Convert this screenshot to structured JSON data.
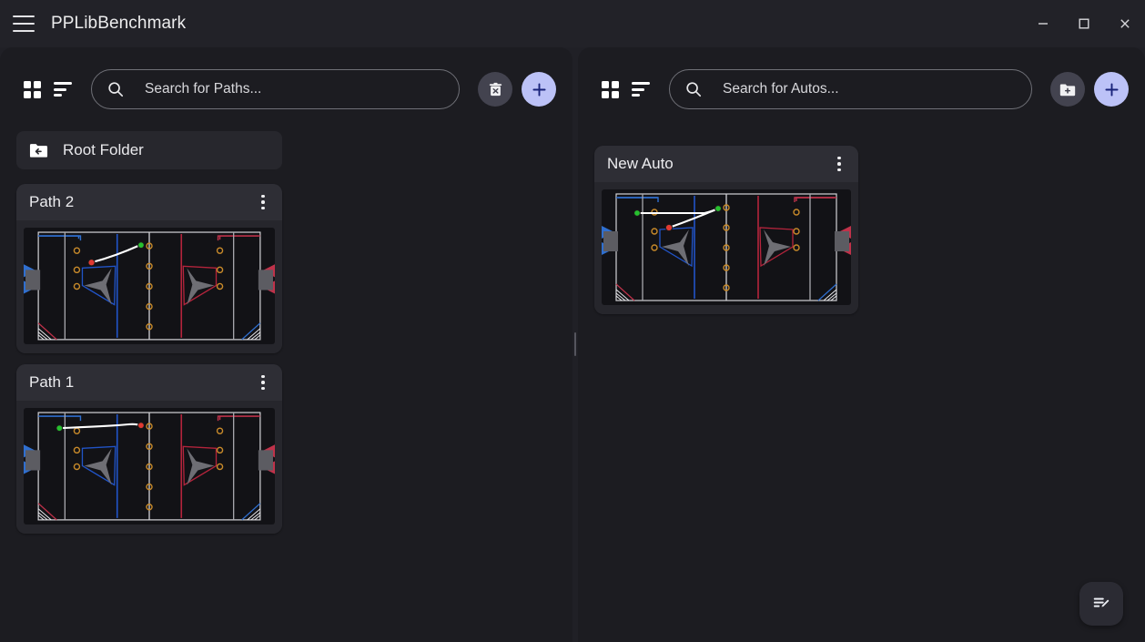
{
  "window": {
    "title": "PPLibBenchmark",
    "menu_icon": "hamburger-menu-icon",
    "controls": {
      "minimize": "minimize-icon",
      "maximize": "maximize-icon",
      "close": "close-icon"
    }
  },
  "paths_panel": {
    "toolbar": {
      "grid_view_icon": "grid-view-icon",
      "sort_icon": "sort-icon",
      "search_icon": "search-icon",
      "search_value": "",
      "search_placeholder": "Search for Paths...",
      "delete_all_icon": "trash-delete-icon",
      "add_icon": "plus-icon"
    },
    "root_folder": {
      "icon": "folder-back-icon",
      "label": "Root Folder"
    },
    "cards": [
      {
        "title": "Path 2",
        "menu_icon": "kebab-menu-icon",
        "preview": "path-preview-field"
      },
      {
        "title": "Path 1",
        "menu_icon": "kebab-menu-icon",
        "preview": "path-preview-field"
      }
    ]
  },
  "autos_panel": {
    "toolbar": {
      "grid_view_icon": "grid-view-icon",
      "sort_icon": "sort-icon",
      "search_icon": "search-icon",
      "search_value": "",
      "search_placeholder": "Search for Autos...",
      "new_folder_icon": "folder-add-icon",
      "add_icon": "plus-icon"
    },
    "cards": [
      {
        "title": "New Auto",
        "menu_icon": "kebab-menu-icon",
        "preview": "auto-preview-field"
      }
    ]
  },
  "fab": {
    "icon": "edit-note-icon",
    "label": ""
  },
  "colors": {
    "window_bg": "#202026",
    "titlebar_bg": "#222228",
    "panel_bg": "#1c1c21",
    "card_bg": "#26262c",
    "card_header_bg": "#2e2e35",
    "accent": "#bcc2f7",
    "accent_fg": "#19237a",
    "text": "#ececef",
    "field_blue": "#2f6fd0",
    "field_red": "#c0324a",
    "field_note": "#c88a2a",
    "waypoint_start": "#27c02f",
    "waypoint_end": "#e03a32"
  }
}
